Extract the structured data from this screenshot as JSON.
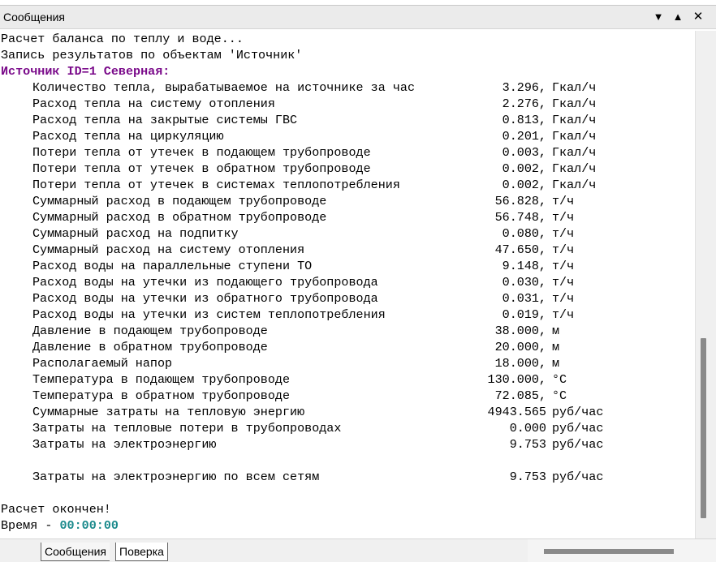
{
  "window": {
    "title": "Сообщения",
    "controls": [
      {
        "name": "dropdown-icon",
        "glyph": "▼"
      },
      {
        "name": "maximize-icon",
        "glyph": "▲"
      },
      {
        "name": "close-icon",
        "glyph": "✕"
      }
    ]
  },
  "log": {
    "header_lines": [
      "Расчет баланса по теплу и воде...",
      "Запись результатов по объектам 'Источник'"
    ],
    "source_title": "Источник ID=1 Северная:",
    "rows": [
      {
        "label": "Количество тепла, вырабатываемое на источнике за час",
        "value": "3.296,",
        "unit": "Гкал/ч"
      },
      {
        "label": "Расход тепла на систему отопления",
        "value": "2.276,",
        "unit": "Гкал/ч"
      },
      {
        "label": "Расход тепла на закрытые системы ГВС",
        "value": "0.813,",
        "unit": "Гкал/ч"
      },
      {
        "label": "Расход тепла на циркуляцию",
        "value": "0.201,",
        "unit": "Гкал/ч"
      },
      {
        "label": "Потери тепла от утечек в подающем трубопроводе",
        "value": "0.003,",
        "unit": "Гкал/ч"
      },
      {
        "label": "Потери тепла от утечек в обратном трубопроводе",
        "value": "0.002,",
        "unit": "Гкал/ч"
      },
      {
        "label": "Потери тепла от утечек в системах теплопотребления",
        "value": "0.002,",
        "unit": "Гкал/ч"
      },
      {
        "label": "Суммарный расход в подающем трубопроводе",
        "value": "56.828,",
        "unit": "т/ч"
      },
      {
        "label": "Суммарный расход в обратном трубопроводе",
        "value": "56.748,",
        "unit": "т/ч"
      },
      {
        "label": "Суммарный расход на подпитку",
        "value": "0.080,",
        "unit": "т/ч"
      },
      {
        "label": "Суммарный расход на систему отопления",
        "value": "47.650,",
        "unit": "т/ч"
      },
      {
        "label": "Расход воды на параллельные ступени ТО",
        "value": "9.148,",
        "unit": "т/ч"
      },
      {
        "label": "Расход воды на утечки из подающего трубопровода",
        "value": "0.030,",
        "unit": "т/ч"
      },
      {
        "label": "Расход воды на утечки из обратного трубопровода",
        "value": "0.031,",
        "unit": "т/ч"
      },
      {
        "label": "Расход воды на утечки из систем теплопотребления",
        "value": "0.019,",
        "unit": "т/ч"
      },
      {
        "label": "Давление в подающем трубопроводе",
        "value": "38.000,",
        "unit": "м"
      },
      {
        "label": "Давление в обратном трубопроводе",
        "value": "20.000,",
        "unit": "м"
      },
      {
        "label": "Располагаемый напор",
        "value": "18.000,",
        "unit": "м"
      },
      {
        "label": "Температура в подающем трубопроводе",
        "value": "130.000,",
        "unit": "°C"
      },
      {
        "label": "Температура в обратном трубопроводе",
        "value": "72.085,",
        "unit": "°C"
      },
      {
        "label": "Суммарные затраты на тепловую энергию",
        "value": "4943.565",
        "unit": "руб/час"
      },
      {
        "label": "Затраты на тепловые потери в трубопроводах",
        "value": "0.000",
        "unit": "руб/час"
      },
      {
        "label": "Затраты на электроэнергию",
        "value": "9.753",
        "unit": "руб/час"
      }
    ],
    "total_row": {
      "label": "Затраты на электроэнергию по всем сетям",
      "value": "9.753",
      "unit": "руб/час"
    },
    "done_line": "Расчет окончен!",
    "time_label": "Время - ",
    "time_value": "00:00:00"
  },
  "tabs": [
    {
      "label": "Сообщения",
      "active": false
    },
    {
      "label": "Поверка",
      "active": true
    }
  ],
  "colors": {
    "source_title": "#7a0a8a",
    "time_value": "#1b8a8c"
  }
}
